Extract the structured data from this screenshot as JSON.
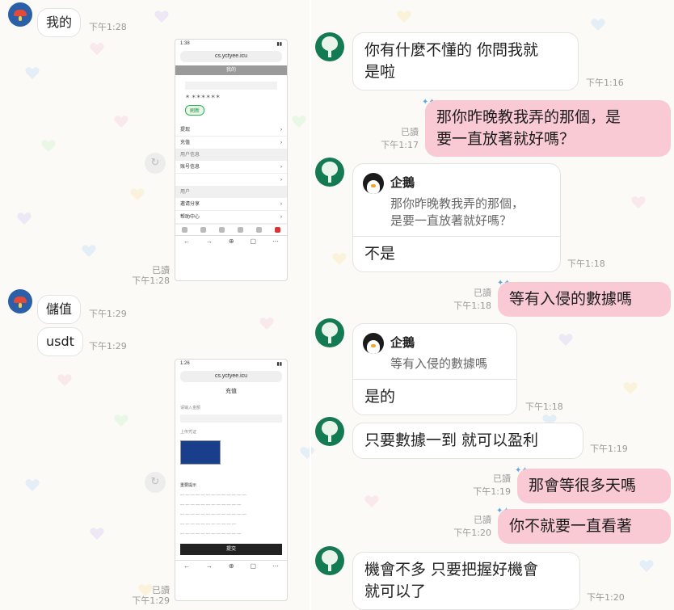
{
  "colors": {
    "pink": "#f9c9d4",
    "white_bubble": "#ffffff",
    "timestamp": "#9a9a9a"
  },
  "left": {
    "messages": [
      {
        "text": "我的",
        "time": "下午1:28"
      },
      {
        "read": "已讀",
        "time": "下午1:28"
      },
      {
        "text": "儲值",
        "time": "下午1:29"
      },
      {
        "text": "usdt",
        "time": "下午1:29"
      },
      {
        "read": "已讀",
        "time": "下午1:29"
      }
    ],
    "phone1": {
      "status_time": "1:38",
      "url": "cs.yctyee.icu",
      "bar": "我的",
      "rows": [
        "提现",
        "充值",
        "用户信息",
        "账号信息",
        "用户",
        "邀请分享",
        "帮助中心"
      ],
      "button": "刷新",
      "stars": "＊ ＊＊＊＊＊＊"
    },
    "phone2": {
      "status_time": "1:26",
      "url": "cs.yctyee.icu",
      "title": "充值",
      "fields": [
        "请输入金额",
        "上传凭证"
      ],
      "section": "重要提示",
      "submit": "提交"
    }
  },
  "right": {
    "m1": {
      "text": "你有什麼不懂的 你問我就\n是啦",
      "time": "下午1:16"
    },
    "m2": {
      "text": "那你昨晚教我弄的那個，是\n要一直放著就好嗎？",
      "read": "已讀",
      "time": "下午1:17"
    },
    "m3": {
      "name": "企鵝",
      "quote": "那你昨晚教我弄的那個，\n是要一直放著就好嗎？",
      "text": "不是",
      "time": "下午1:18"
    },
    "m4": {
      "text": "等有入侵的數據嗎",
      "read": "已讀",
      "time": "下午1:18"
    },
    "m5": {
      "name": "企鵝",
      "quote": "等有入侵的數據嗎",
      "text": "是的",
      "time": "下午1:18"
    },
    "m6": {
      "text": "只要數據一到 就可以盈利",
      "time": "下午1:19"
    },
    "m7": {
      "text": "那會等很多天嗎",
      "read": "已讀",
      "time": "下午1:19"
    },
    "m8": {
      "text": "你不就要一直看著",
      "read": "已讀",
      "time": "下午1:20"
    },
    "m9": {
      "text": "機會不多 只要把握好機會\n就可以了",
      "time": "下午1:20"
    }
  }
}
